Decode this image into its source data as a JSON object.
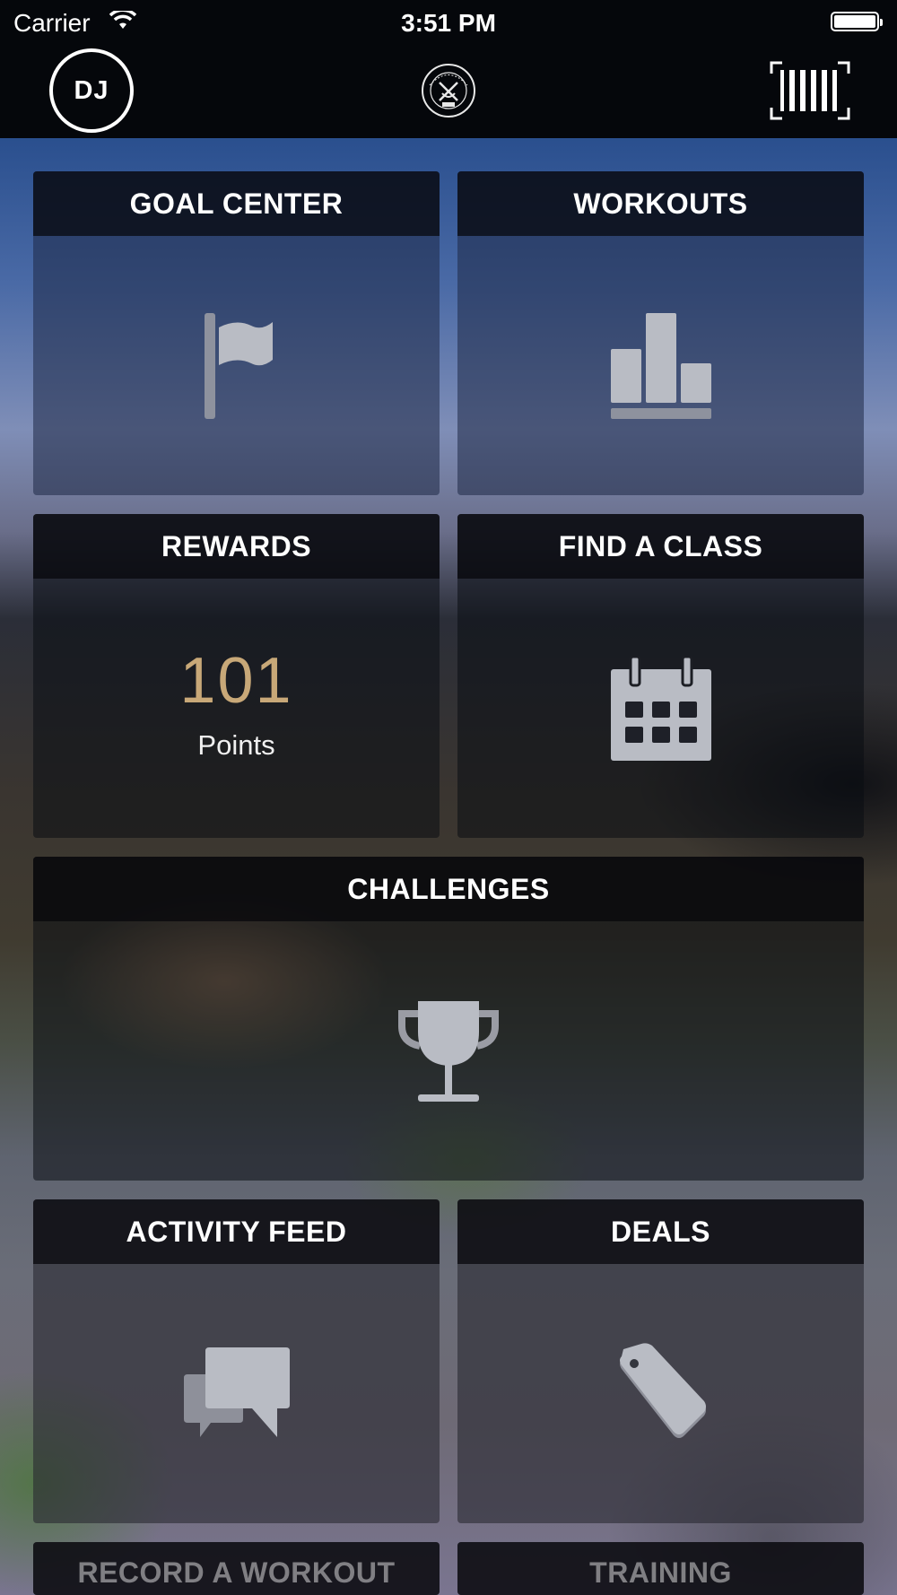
{
  "status_bar": {
    "carrier": "Carrier",
    "time": "3:51 PM"
  },
  "nav": {
    "avatar_initials": "DJ",
    "logo_icon": "club-crest-icon",
    "scan_icon": "barcode-scan-icon"
  },
  "tiles": {
    "goal_center": {
      "label": "GOAL CENTER",
      "icon": "flag-icon"
    },
    "workouts": {
      "label": "WORKOUTS",
      "icon": "bar-chart-icon"
    },
    "rewards": {
      "label": "REWARDS",
      "points": "101",
      "points_label": "Points"
    },
    "find_a_class": {
      "label": "FIND A CLASS",
      "icon": "calendar-icon"
    },
    "challenges": {
      "label": "CHALLENGES",
      "icon": "trophy-icon"
    },
    "activity_feed": {
      "label": "ACTIVITY FEED",
      "icon": "chat-bubbles-icon"
    },
    "deals": {
      "label": "DEALS",
      "icon": "price-tag-icon"
    },
    "record_a_workout": {
      "label": "RECORD A WORKOUT"
    },
    "training": {
      "label": "TRAINING"
    }
  },
  "colors": {
    "points_accent": "#c8a878",
    "icon_fill": "#b9bcc4",
    "bar_background": "#05070b"
  }
}
